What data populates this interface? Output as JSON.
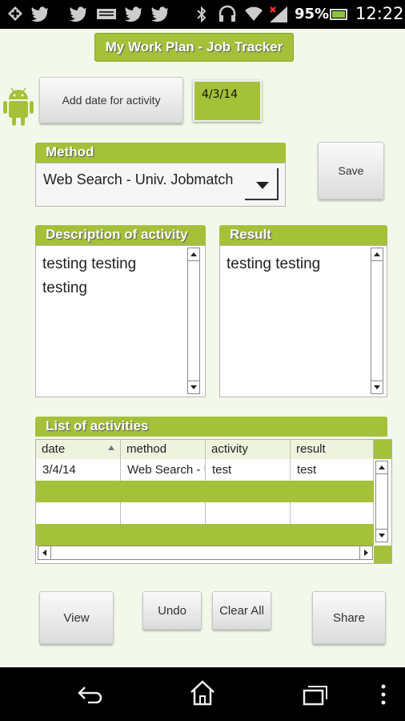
{
  "status_bar": {
    "battery_percent": "95%",
    "time": "12:22",
    "icons": [
      "add-icon",
      "twitter-icon",
      "twitter-icon",
      "keyboard-icon",
      "twitter-icon",
      "twitter-icon",
      "bluetooth-icon",
      "headset-icon",
      "wifi-icon",
      "signal-icon",
      "battery-icon"
    ]
  },
  "app": {
    "title": "My Work Plan - Job Tracker",
    "accent_color": "#a4c139"
  },
  "date_row": {
    "add_date_label": "Add date for activity",
    "date_value": "4/3/14"
  },
  "method": {
    "label": "Method",
    "selected": "Web Search - Univ. Jobmatch"
  },
  "save_label": "Save",
  "description": {
    "label": "Description of activity",
    "value": "testing testing testing"
  },
  "result": {
    "label": "Result",
    "value": "testing testing"
  },
  "activities": {
    "label": "List of activities",
    "columns": [
      "date",
      "method",
      "activity",
      "result"
    ],
    "rows": [
      [
        "3/4/14",
        "Web Search - Univ. Jobmatch",
        "test",
        "test"
      ]
    ]
  },
  "buttons": {
    "view": "View",
    "undo": "Undo",
    "clear_all": "Clear All",
    "share": "Share"
  },
  "nav_icons": [
    "back-icon",
    "home-icon",
    "recent-apps-icon",
    "overflow-menu-icon"
  ]
}
